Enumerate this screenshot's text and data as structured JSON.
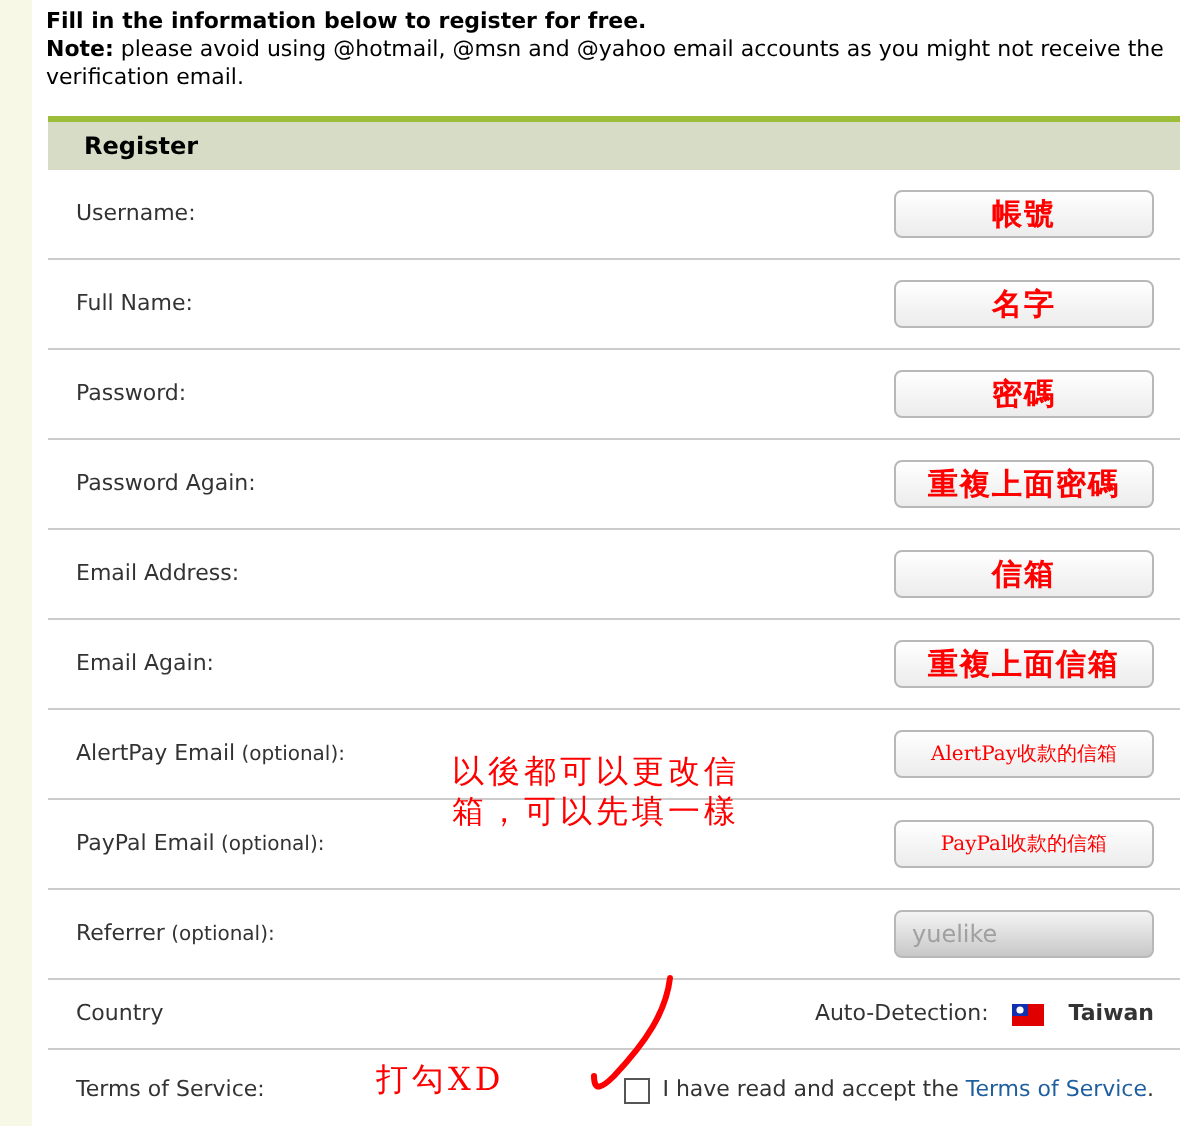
{
  "intro": {
    "title": "Fill in the information below to register for free.",
    "note": "**Note:** please avoid using @hotmail, @msn and @yahoo email accounts as you might not receive the verification email."
  },
  "form": {
    "title": "Register",
    "fields": [
      {
        "label": "Username:",
        "value": "帳號",
        "kind": "annotated"
      },
      {
        "label": "Full Name:",
        "value": "名字",
        "kind": "annotated"
      },
      {
        "label": "Password:",
        "value": "密碼",
        "kind": "annotated"
      },
      {
        "label": "Password Again:",
        "value": "重複上面密碼",
        "kind": "annotated"
      },
      {
        "label": "Email Address:",
        "value": "信箱",
        "kind": "annotated"
      },
      {
        "label": "Email Again:",
        "value": "重複上面信箱",
        "kind": "annotated"
      },
      {
        "label": "AlertPay Email",
        "optional": "(optional):",
        "value": "AlertPay收款的信箱",
        "kind": "annotated"
      },
      {
        "label": "PayPal Email",
        "optional": "(optional):",
        "value": "PayPal收款的信箱",
        "kind": "annotated"
      },
      {
        "label": "Referrer",
        "optional": "(optional):",
        "value": "yuelike",
        "kind": "disabled"
      }
    ],
    "country": {
      "label": "Country",
      "detection_label": "Auto-Detection:",
      "value": "Taiwan"
    },
    "terms": {
      "label": "Terms of Service:",
      "checked": false,
      "text": "I have read and accept the",
      "link": "Terms of Service",
      "end": "."
    }
  },
  "annotations": [
    {
      "text": "以後都可以更改信箱，可以先填一樣"
    },
    {
      "text": "打勾XD"
    }
  ]
}
